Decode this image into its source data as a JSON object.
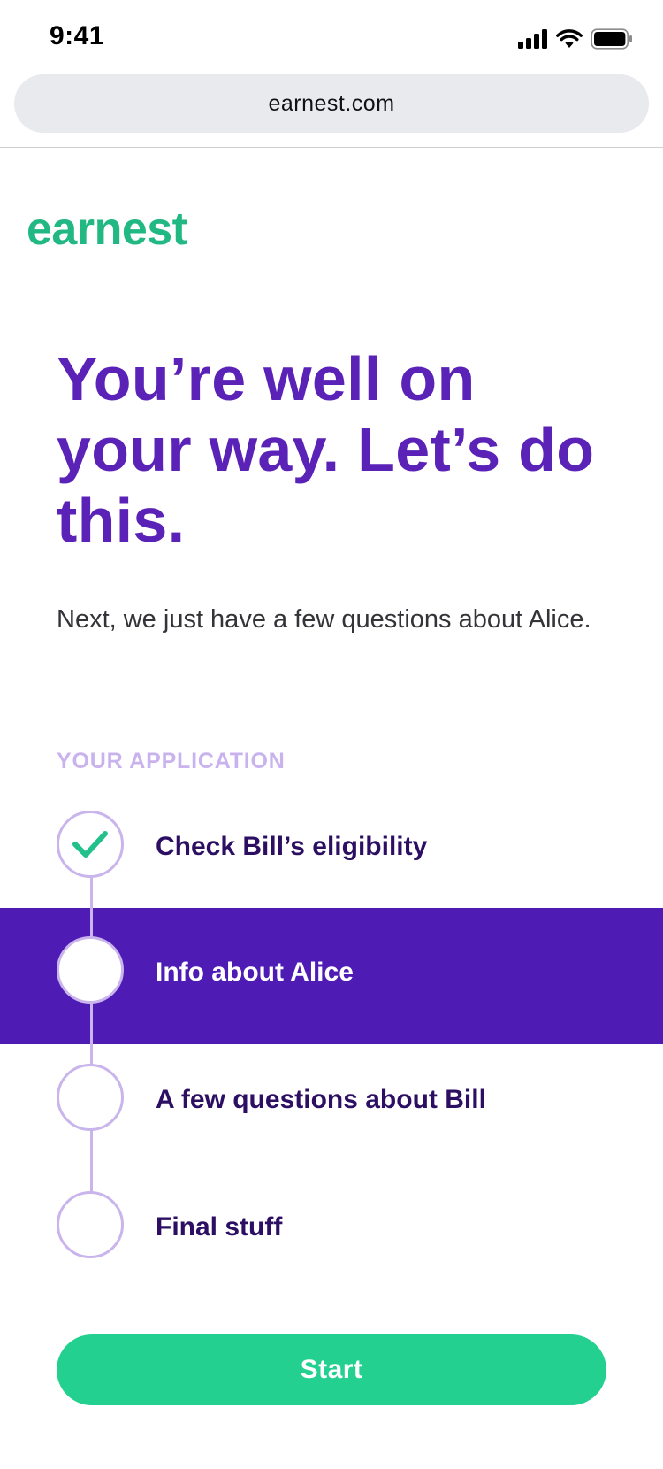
{
  "status_bar": {
    "time": "9:41",
    "icons": [
      "signal-icon",
      "wifi-icon",
      "battery-icon"
    ]
  },
  "browser": {
    "url": "earnest.com"
  },
  "brand": {
    "logo_text": "earnest",
    "logo_color": "#22b884"
  },
  "main": {
    "headline": "You’re well on your way. Let’s do this.",
    "intro": "Next, we just have a few questions about Alice.",
    "section_label": "YOUR APPLICATION",
    "steps": [
      {
        "label": "Check Bill’s eligibility",
        "status": "complete"
      },
      {
        "label": "Info about Alice",
        "status": "current"
      },
      {
        "label": "A few questions about Bill",
        "status": "upcoming"
      },
      {
        "label": "Final stuff",
        "status": "upcoming"
      }
    ],
    "start_label": "Start"
  },
  "colors": {
    "headline": "#5a22b6",
    "active_band": "#4f1bb5",
    "step_text": "#2c0f63",
    "section_label": "#c9b3ee",
    "step_ring": "#c9b5ec",
    "accent_green": "#23d08f",
    "checkmark": "#22c08a"
  }
}
